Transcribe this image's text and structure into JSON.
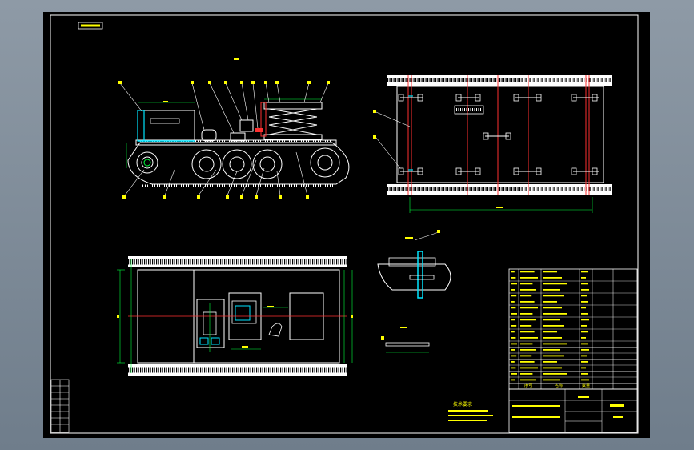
{
  "colors": {
    "viewport_bg": "#7d8b99",
    "paper": "#000000",
    "line": "#ffffff",
    "dim": "#00ff3c",
    "text": "#ffff00",
    "cyan": "#00e5ff",
    "red": "#ff3030",
    "magenta": "#ff00ff"
  },
  "drawing": {
    "note_title": "技术要求"
  },
  "title_block": {
    "labels": [
      "序号",
      "名称",
      "数量"
    ]
  }
}
